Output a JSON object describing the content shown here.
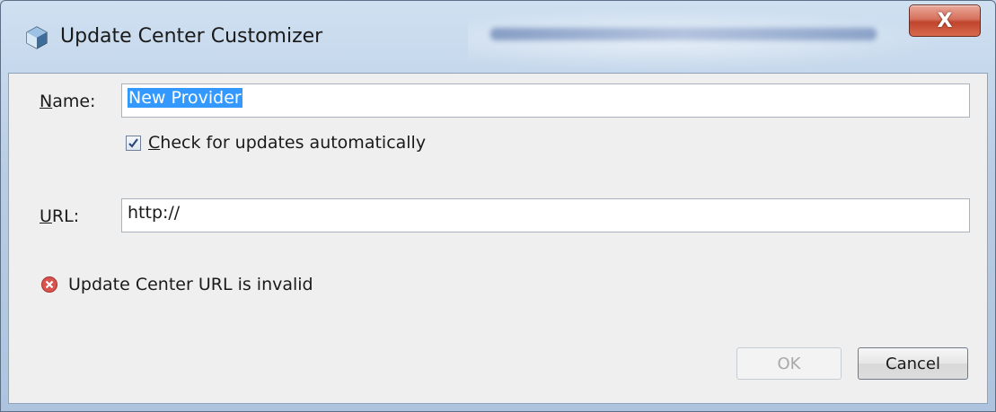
{
  "window": {
    "title": "Update Center Customizer",
    "close_glyph": "X",
    "icon": "cube-icon"
  },
  "form": {
    "name_label": "Name:",
    "name_mnemonic": "N",
    "name_rest": "ame:",
    "name_value": "New Provider",
    "check_label_mnemonic": "C",
    "check_label_rest": "heck for updates automatically",
    "check_label": "Check for updates automatically",
    "check_checked": true,
    "url_label_mnemonic": "U",
    "url_label_rest": "RL:",
    "url_label": "URL:",
    "url_value": "http://"
  },
  "status": {
    "error_icon": "error-icon",
    "error_color": "#d9534f",
    "message": "Update Center URL is invalid"
  },
  "buttons": {
    "ok_label": "OK",
    "ok_enabled": false,
    "cancel_label": "Cancel"
  }
}
